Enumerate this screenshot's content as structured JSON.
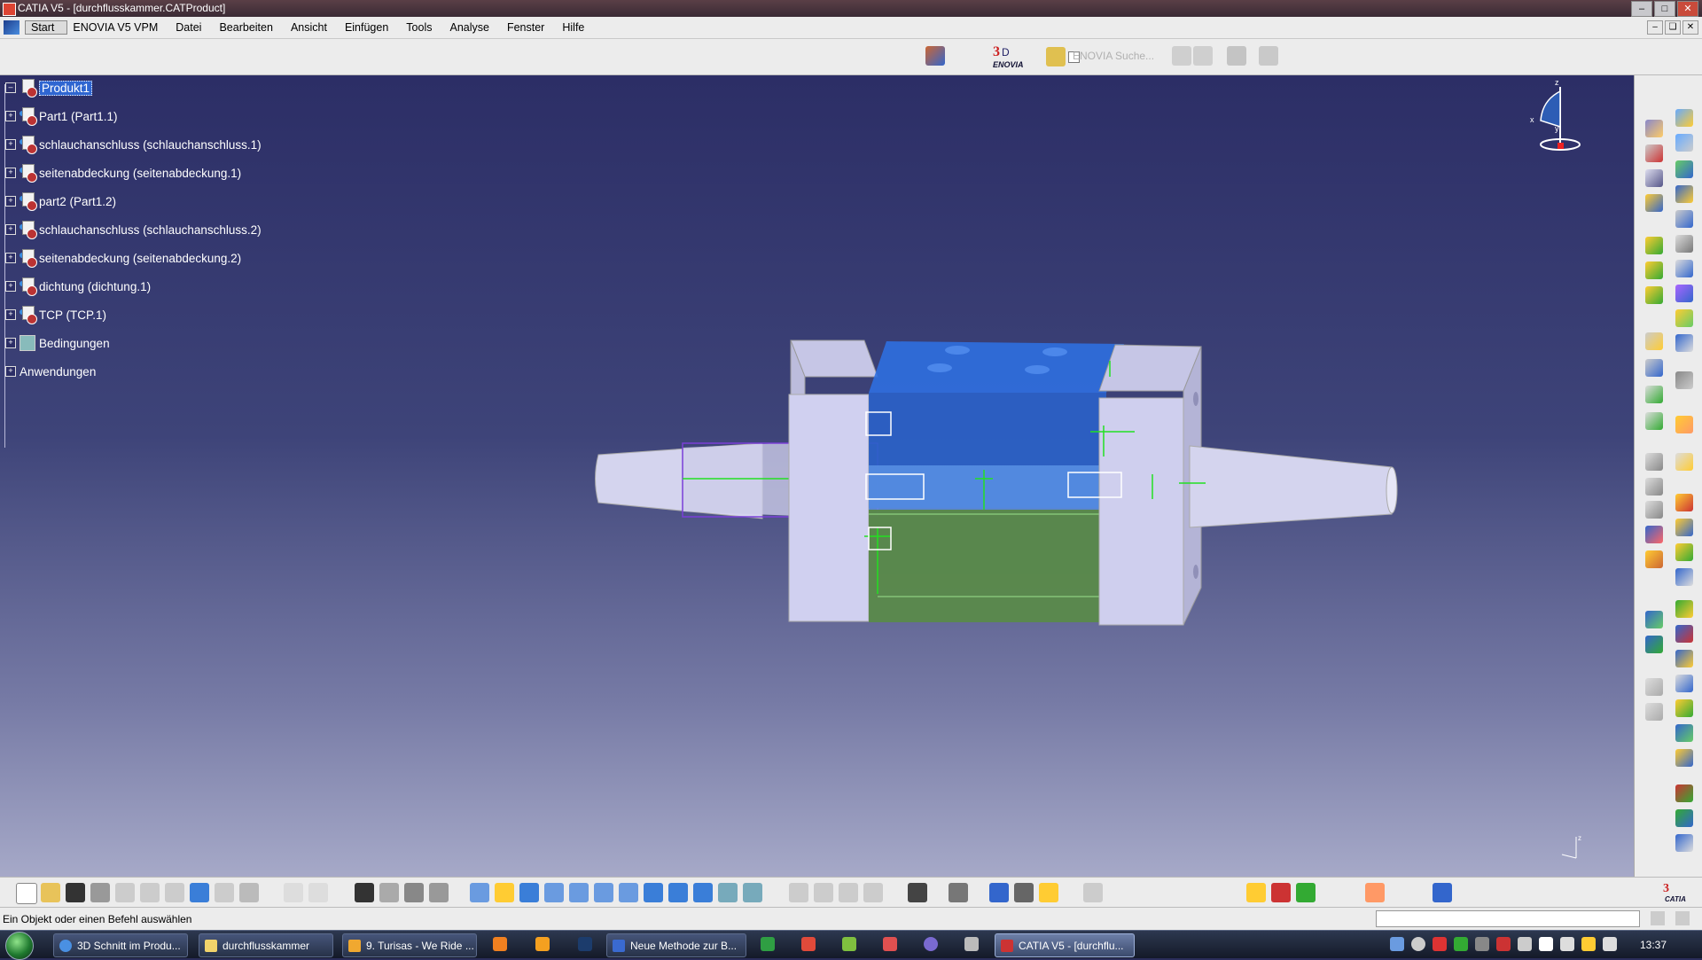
{
  "window": {
    "title": "CATIA V5 - [durchflusskammer.CATProduct]"
  },
  "menu": {
    "items": [
      "Start",
      "ENOVIA V5 VPM",
      "Datei",
      "Bearbeiten",
      "Ansicht",
      "Einfügen",
      "Tools",
      "Analyse",
      "Fenster",
      "Hilfe"
    ]
  },
  "toolbar": {
    "enovia_search": "ENOVIA Suche..."
  },
  "tree": {
    "root": "Produkt1",
    "items": [
      "Part1 (Part1.1)",
      "schlauchanschluss (schlauchanschluss.1)",
      "seitenabdeckung (seitenabdeckung.1)",
      "part2 (Part1.2)",
      "schlauchanschluss (schlauchanschluss.2)",
      "seitenabdeckung (seitenabdeckung.2)",
      "dichtung (dichtung.1)",
      "TCP (TCP.1)",
      "Bedingungen",
      "Anwendungen"
    ]
  },
  "compass": {
    "x": "x",
    "y": "y",
    "z": "z"
  },
  "status": {
    "message": "Ein Objekt oder einen Befehl auswählen"
  },
  "taskbar": {
    "tasks": [
      "3D Schnitt im Produ...",
      "durchflusskammer",
      "9. Turisas - We Ride ...",
      "Neue Methode zur B...",
      "CATIA V5 - [durchflu..."
    ],
    "clock": "13:37"
  },
  "colors": {
    "viewport_top": "#2c2e66",
    "viewport_bottom": "#a6a9c8",
    "selection": "#2f66d1",
    "part_blue": "#2f6fe0",
    "part_green": "#5a8a4a",
    "constraint_green": "#22e022"
  }
}
